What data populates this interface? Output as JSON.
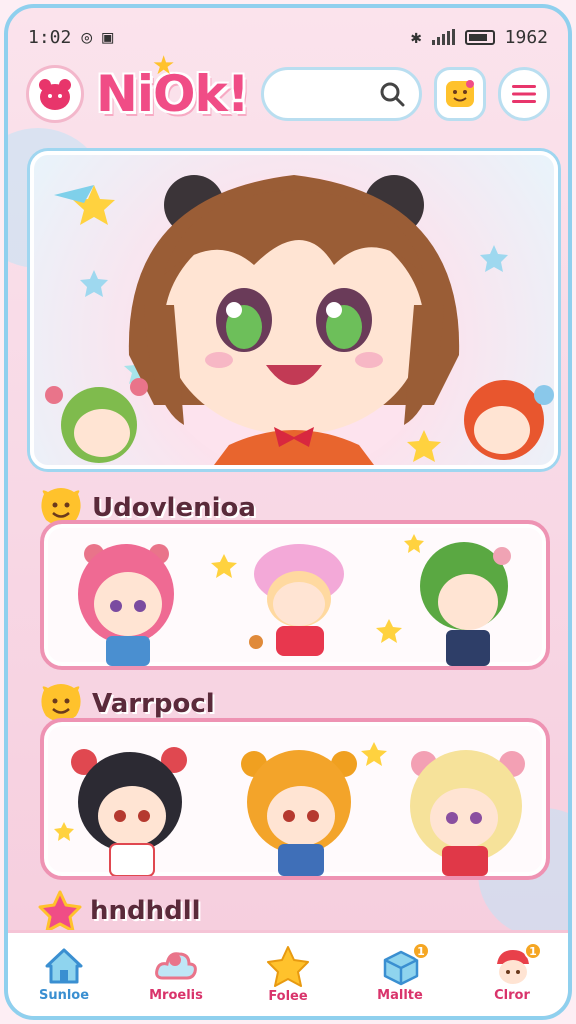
{
  "status_bar": {
    "time": "1:02",
    "battery": "1962"
  },
  "header": {
    "logo_text": "NiOk!",
    "search_placeholder": ""
  },
  "sections": [
    {
      "title": "Udovlenioa"
    },
    {
      "title": "Varrpocl"
    },
    {
      "title": "hndhdll"
    }
  ],
  "nav": [
    {
      "label": "Sunloe",
      "color": "#3a8fd1",
      "icon": "home-icon"
    },
    {
      "label": "Mroelis",
      "color": "#d9346b",
      "icon": "cloud-icon"
    },
    {
      "label": "Folee",
      "color": "#d9346b",
      "icon": "star-icon"
    },
    {
      "label": "Mallte",
      "color": "#d9346b",
      "icon": "box-icon",
      "badge": "1"
    },
    {
      "label": "Clror",
      "color": "#d9346b",
      "icon": "character-icon",
      "badge": "1"
    }
  ],
  "colors": {
    "accent": "#f04d86",
    "frame": "#8fd0ee",
    "card_border": "#ee93b3"
  }
}
